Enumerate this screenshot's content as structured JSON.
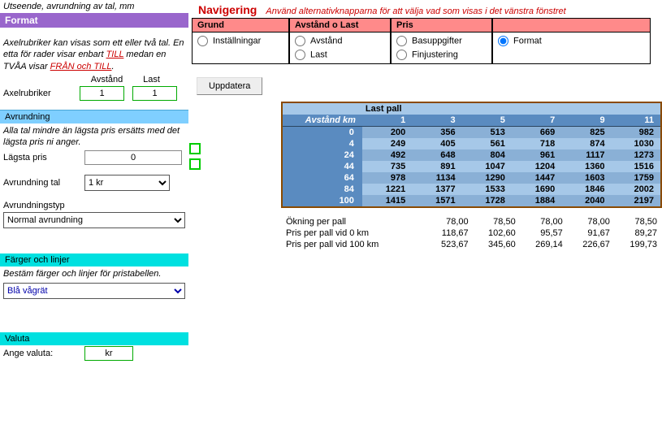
{
  "left": {
    "subtitle": "Utseende, avrundning av tal, mm",
    "header": "Format",
    "desc_prefix": "Axelrubriker kan visas som ett eller två tal. En etta för rader visar enbart ",
    "desc_link1": "TILL",
    "desc_middle": " medan en TVÅA visar ",
    "desc_link2": "FRÅN och TILL",
    "desc_suffix": ".",
    "col_avstand": "Avstånd",
    "col_last": "Last",
    "label_axelrubriker": "Axelrubriker",
    "val_avstand": "1",
    "val_last": "1",
    "sect_avrundning": "Avrundning",
    "avrundning_desc": "Alla tal mindre än lägsta pris ersätts med det lägsta pris ni anger.",
    "label_lagsta": "Lägsta pris",
    "val_lagsta": "0",
    "label_avrundning_tal": "Avrundning tal",
    "val_avrundning_tal": "1 kr",
    "label_avrundningstyp": "Avrundningstyp",
    "val_avrundningstyp": "Normal avrundning",
    "sect_farger": "Färger och linjer",
    "farger_desc": "Bestäm färger och linjer för pristabellen.",
    "val_farger": "Blå vågrät",
    "sect_valuta": "Valuta",
    "label_valuta": "Ange valuta:",
    "val_valuta": "kr"
  },
  "nav": {
    "title": "Navigering",
    "hint": "Använd alternativknapparna för att välja vad som visas i det vänstra fönstret",
    "cols": [
      {
        "head": "Grund",
        "items": [
          "Inställningar"
        ]
      },
      {
        "head": "Avstånd o Last",
        "items": [
          "Avstånd",
          "Last"
        ]
      },
      {
        "head": "Pris",
        "items": [
          "Basuppgifter",
          "Finjustering"
        ]
      },
      {
        "head": "",
        "items": [
          "Format"
        ]
      }
    ],
    "selected": "Format"
  },
  "btn_update": "Uppdatera",
  "grid": {
    "title": "Last pall",
    "row_head": "Avstånd km",
    "cols": [
      "1",
      "3",
      "5",
      "7",
      "9",
      "11"
    ],
    "row_labels": [
      "0",
      "4",
      "24",
      "44",
      "64",
      "84",
      "100"
    ],
    "data": [
      [
        "200",
        "356",
        "513",
        "669",
        "825",
        "982"
      ],
      [
        "249",
        "405",
        "561",
        "718",
        "874",
        "1030"
      ],
      [
        "492",
        "648",
        "804",
        "961",
        "1117",
        "1273"
      ],
      [
        "735",
        "891",
        "1047",
        "1204",
        "1360",
        "1516"
      ],
      [
        "978",
        "1134",
        "1290",
        "1447",
        "1603",
        "1759"
      ],
      [
        "1221",
        "1377",
        "1533",
        "1690",
        "1846",
        "2002"
      ],
      [
        "1415",
        "1571",
        "1728",
        "1884",
        "2040",
        "2197"
      ]
    ]
  },
  "summary": {
    "rows": [
      {
        "label": "Ökning per pall",
        "vals": [
          "78,00",
          "78,50",
          "78,00",
          "78,00",
          "78,50"
        ]
      },
      {
        "label": "Pris per pall vid 0 km",
        "vals": [
          "118,67",
          "102,60",
          "95,57",
          "91,67",
          "89,27"
        ]
      },
      {
        "label": "Pris per pall vid 100 km",
        "vals": [
          "523,67",
          "345,60",
          "269,14",
          "226,67",
          "199,73"
        ]
      }
    ]
  }
}
